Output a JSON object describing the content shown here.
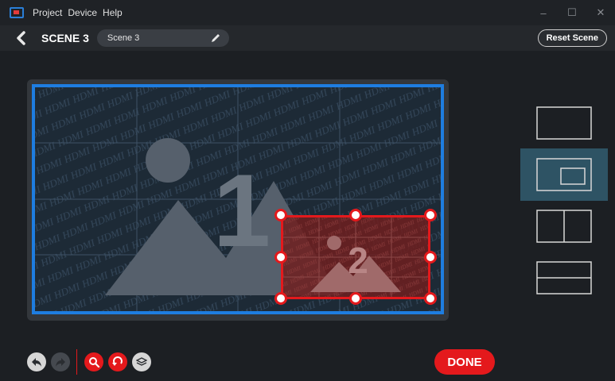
{
  "menu": {
    "items": [
      "Project",
      "Device",
      "Help"
    ]
  },
  "window_controls": {
    "minimize": "–",
    "maximize": "☐",
    "close": "✕"
  },
  "header": {
    "scene_label": "SCENE 3",
    "scene_name": "Scene 3",
    "reset_label": "Reset Scene"
  },
  "canvas": {
    "watermark": "HDMI",
    "window1_number": "1",
    "window2_number": "2"
  },
  "layouts": [
    {
      "name": "single",
      "active": false
    },
    {
      "name": "picture-in-picture",
      "active": true
    },
    {
      "name": "side-by-side",
      "active": false
    },
    {
      "name": "top-bottom",
      "active": false
    }
  ],
  "toolbar": {
    "done_label": "DONE",
    "icons": [
      "undo-icon",
      "redo-icon",
      "zoom-icon",
      "reset-icon",
      "layers-icon"
    ]
  },
  "colors": {
    "accent_blue": "#1e7de0",
    "accent_red": "#e4191c",
    "active_layout": "#2e5364"
  }
}
